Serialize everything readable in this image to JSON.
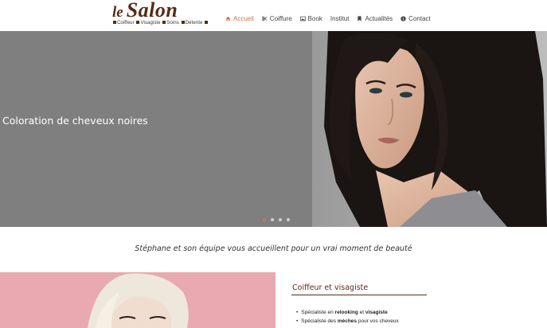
{
  "logo": {
    "word_le": "le",
    "word_salon": "Salon",
    "tagline_items": [
      "Coiffeur",
      "Visagiste",
      "Soins",
      "Détente"
    ]
  },
  "nav": {
    "items": [
      {
        "label": "Accueil",
        "icon": "home-icon",
        "active": true
      },
      {
        "label": "Coiffure",
        "icon": "scissors-icon",
        "active": false
      },
      {
        "label": "Book",
        "icon": "image-icon",
        "active": false
      },
      {
        "label": "Institut",
        "icon": "",
        "active": false
      },
      {
        "label": "Actualités",
        "icon": "bookmark-icon",
        "active": false
      },
      {
        "label": "Contact",
        "icon": "info-icon",
        "active": false
      }
    ]
  },
  "hero": {
    "caption": "Coloration de cheveux noires",
    "slide_count": 4,
    "active_slide": 1
  },
  "tagline": "Stéphane et son équipe vous accueillent pour un vrai moment de beauté",
  "section": {
    "title": "Coiffeur et visagiste",
    "bullets": [
      {
        "pre": "Spécialiste en ",
        "b1": "relooking",
        "mid": " et ",
        "b2": "visagiste",
        "post": ""
      },
      {
        "pre": "Spécialiste des ",
        "b1": "mèches",
        "mid": " pour vos cheveux",
        "b2": "",
        "post": ""
      }
    ]
  },
  "colors": {
    "brand": "#5a2a14",
    "accent": "#c9774b",
    "hero_bg": "#7f7f7f",
    "pink_bg": "#e8a9b0"
  }
}
